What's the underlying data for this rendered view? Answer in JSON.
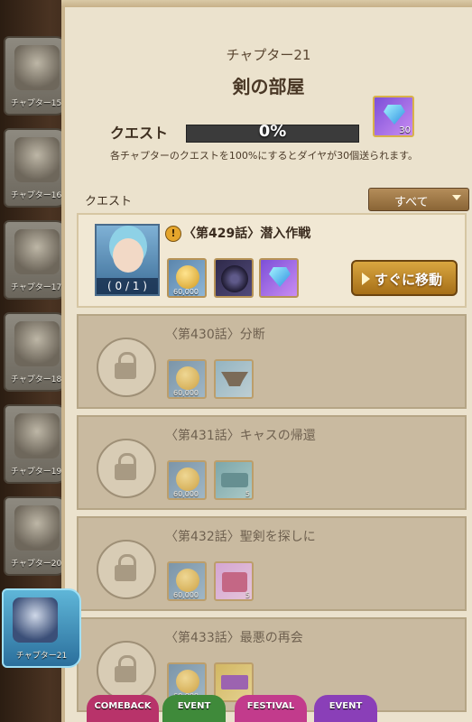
{
  "sidebar": {
    "chapters": [
      {
        "label": "チャプター15"
      },
      {
        "label": "チャプター16"
      },
      {
        "label": "チャプター17"
      },
      {
        "label": "チャプター18"
      },
      {
        "label": "チャプター19"
      },
      {
        "label": "チャプター20"
      },
      {
        "label": "チャプター21"
      }
    ],
    "active_index": 6
  },
  "header": {
    "chapter": "チャプター21",
    "title": "剣の部屋"
  },
  "progress": {
    "label": "クエスト",
    "percent_text": "0%",
    "percent": 0,
    "reward_count": "30",
    "description": "各チャプターのクエストを100%にするとダイヤが30個送られます。"
  },
  "filter": {
    "label": "クエスト",
    "selected": "すべて"
  },
  "quests": [
    {
      "title": "〈第429話〉潜入作戦",
      "progress": "( 0 / 1 )",
      "coin": "60,000",
      "button": "すぐに移動"
    },
    {
      "title": "〈第430話〉分断",
      "coin": "60,000"
    },
    {
      "title": "〈第431話〉キャスの帰還",
      "coin": "60,000",
      "item_qty": "5"
    },
    {
      "title": "〈第432話〉聖剣を探しに",
      "coin": "60,000",
      "item_qty": "5"
    },
    {
      "title": "〈第433話〉最悪の再会",
      "coin": "60,000"
    }
  ],
  "bottom_bar": {
    "buttons": [
      "COMEBACK",
      "EVENT",
      "FESTIVAL",
      "EVENT"
    ]
  },
  "colors": {
    "accent_gold": "#d9a640",
    "panel": "#ebe2cd",
    "active_tab": "#5fb6d8"
  }
}
